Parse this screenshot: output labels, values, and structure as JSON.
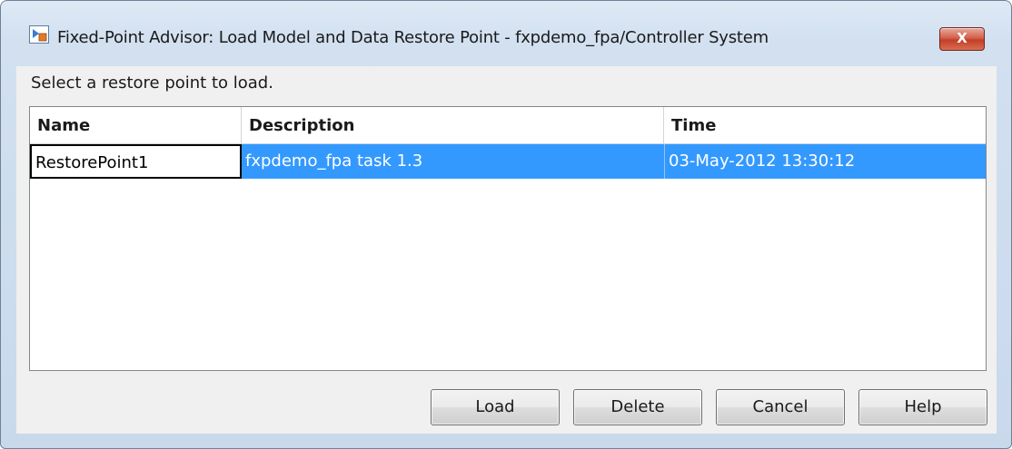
{
  "window": {
    "title": "Fixed-Point Advisor: Load Model and Data Restore Point - fxpdemo_fpa/Controller System",
    "icon": "simulink-model-icon",
    "close_label": "X"
  },
  "prompt": "Select a restore point to load.",
  "table": {
    "columns": [
      "Name",
      "Description",
      "Time"
    ],
    "rows": [
      {
        "name": "RestorePoint1",
        "description": "fxpdemo_fpa task 1.3",
        "time": "03-May-2012 13:30:12",
        "selected": true
      }
    ]
  },
  "buttons": {
    "load": "Load",
    "delete": "Delete",
    "cancel": "Cancel",
    "help": "Help"
  },
  "colors": {
    "selection": "#3399ff",
    "close_button": "#c23f28"
  }
}
